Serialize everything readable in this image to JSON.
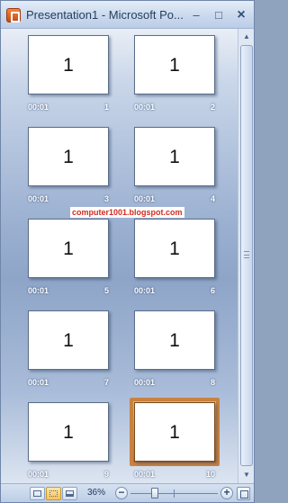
{
  "window": {
    "title": "Presentation1 - Microsoft Po...",
    "minimize_glyph": "–",
    "maximize_glyph": "□",
    "close_glyph": "×"
  },
  "slides": [
    {
      "content": "1",
      "time": "00:01",
      "index": "1"
    },
    {
      "content": "1",
      "time": "00:01",
      "index": "2"
    },
    {
      "content": "1",
      "time": "00:01",
      "index": "3"
    },
    {
      "content": "1",
      "time": "00:01",
      "index": "4"
    },
    {
      "content": "1",
      "time": "00:01",
      "index": "5"
    },
    {
      "content": "1",
      "time": "00:01",
      "index": "6"
    },
    {
      "content": "1",
      "time": "00:01",
      "index": "7"
    },
    {
      "content": "1",
      "time": "00:01",
      "index": "8"
    },
    {
      "content": "1",
      "time": "00:01",
      "index": "9"
    },
    {
      "content": "1",
      "time": "00:01",
      "index": "10"
    }
  ],
  "selected_slide": "10",
  "watermark": "computer1001.blogspot.com",
  "statusbar": {
    "zoom_level": "36%",
    "zoom_minus": "−",
    "zoom_plus": "+"
  },
  "scrollbar": {
    "up_arrow": "▲",
    "down_arrow": "▼"
  },
  "colors": {
    "selection": "#c9823f",
    "watermark_text": "#d42a1e"
  }
}
